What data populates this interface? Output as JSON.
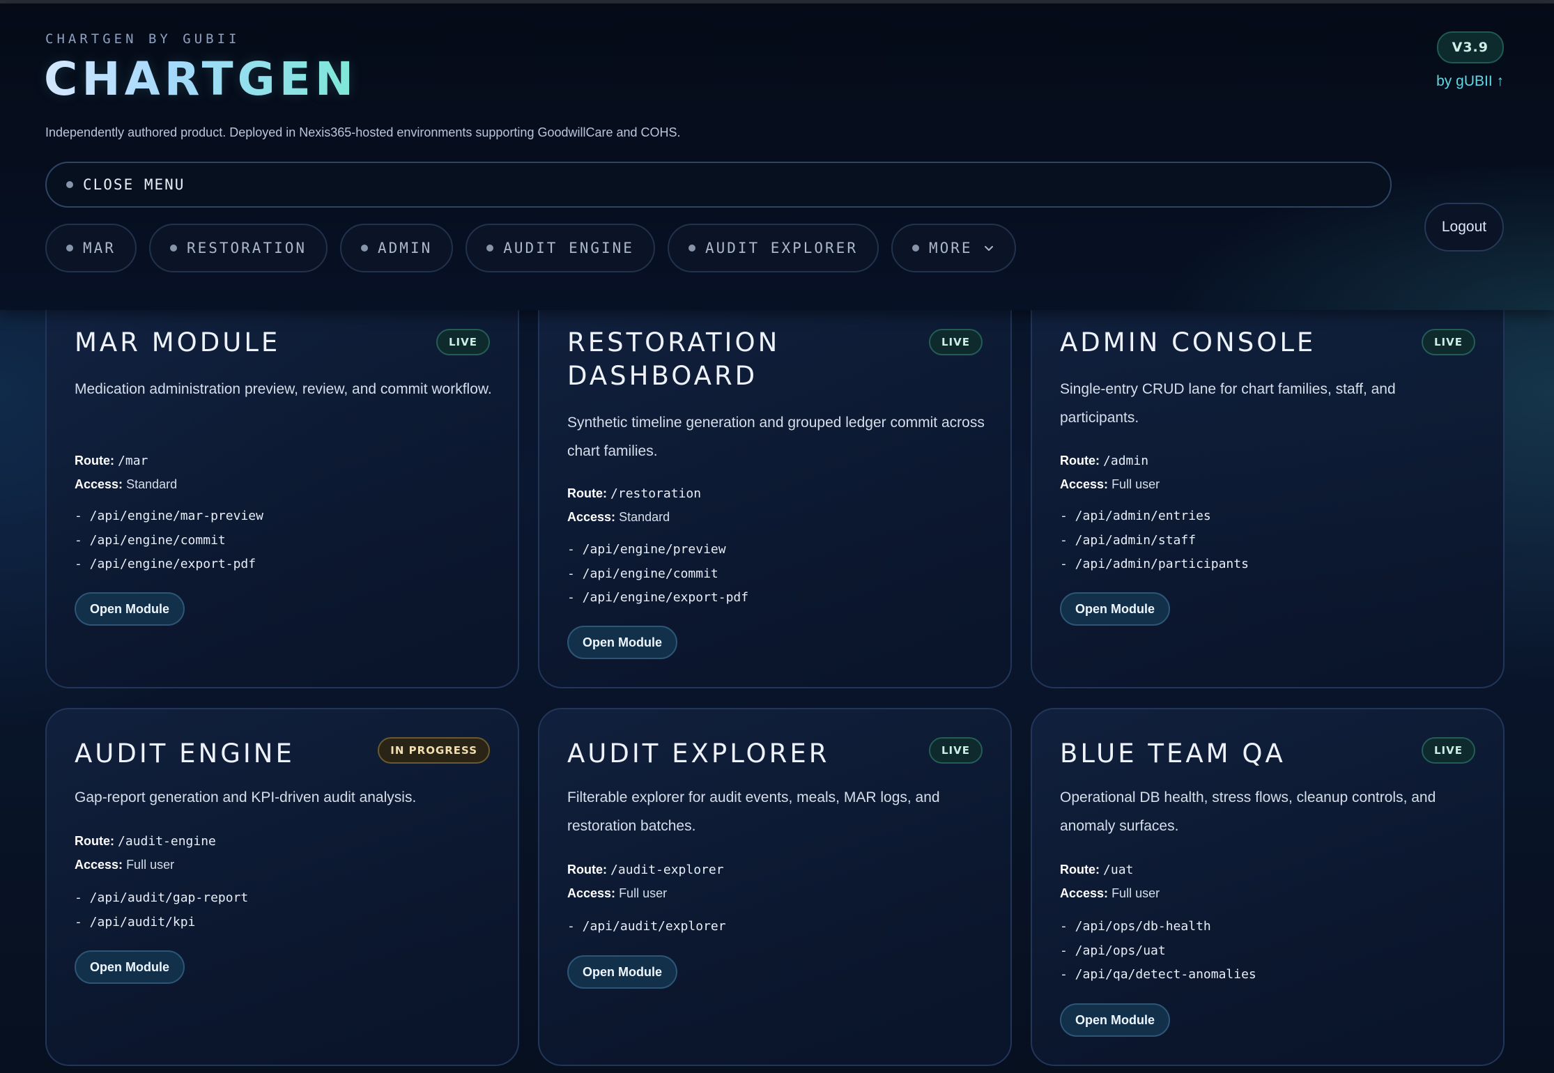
{
  "header": {
    "kicker": "CHARTGEN BY GUBII",
    "title": "CHARTGEN",
    "tagline": "Independently authored product. Deployed in Nexis365-hosted environments supporting GoodwillCare and COHS.",
    "version": "V3.9",
    "by_link": "by gUBII ↑",
    "close_menu": "CLOSE MENU",
    "logout": "Logout",
    "nav": [
      {
        "label": "MAR"
      },
      {
        "label": "RESTORATION"
      },
      {
        "label": "ADMIN"
      },
      {
        "label": "AUDIT ENGINE"
      },
      {
        "label": "AUDIT EXPLORER"
      },
      {
        "label": "MORE"
      }
    ]
  },
  "labels": {
    "route": "Route:",
    "access": "Access:",
    "open": "Open Module"
  },
  "cards": [
    {
      "title": "MAR MODULE",
      "status": "LIVE",
      "description": "Medication administration preview, review, and commit workflow.",
      "route": "/mar",
      "access": "Standard",
      "endpoints": [
        "- /api/engine/mar-preview",
        "- /api/engine/commit",
        "- /api/engine/export-pdf"
      ]
    },
    {
      "title": "RESTORATION DASHBOARD",
      "status": "LIVE",
      "description": "Synthetic timeline generation and grouped ledger commit across chart families.",
      "route": "/restoration",
      "access": "Standard",
      "endpoints": [
        "- /api/engine/preview",
        "- /api/engine/commit",
        "- /api/engine/export-pdf"
      ]
    },
    {
      "title": "ADMIN CONSOLE",
      "status": "LIVE",
      "description": "Single-entry CRUD lane for chart families, staff, and participants.",
      "route": "/admin",
      "access": "Full user",
      "endpoints": [
        "- /api/admin/entries",
        "- /api/admin/staff",
        "- /api/admin/participants"
      ]
    },
    {
      "title": "AUDIT ENGINE",
      "status": "IN PROGRESS",
      "description": "Gap-report generation and KPI-driven audit analysis.",
      "route": "/audit-engine",
      "access": "Full user",
      "endpoints": [
        "- /api/audit/gap-report",
        "- /api/audit/kpi"
      ]
    },
    {
      "title": "AUDIT EXPLORER",
      "status": "LIVE",
      "description": "Filterable explorer for audit events, meals, MAR logs, and restoration batches.",
      "route": "/audit-explorer",
      "access": "Full user",
      "endpoints": [
        "- /api/audit/explorer"
      ]
    },
    {
      "title": "BLUE TEAM QA",
      "status": "LIVE",
      "description": "Operational DB health, stress flows, cleanup controls, and anomaly surfaces.",
      "route": "/uat",
      "access": "Full user",
      "endpoints": [
        "- /api/ops/db-health",
        "- /api/ops/uat",
        "- /api/qa/detect-anomalies"
      ]
    }
  ]
}
